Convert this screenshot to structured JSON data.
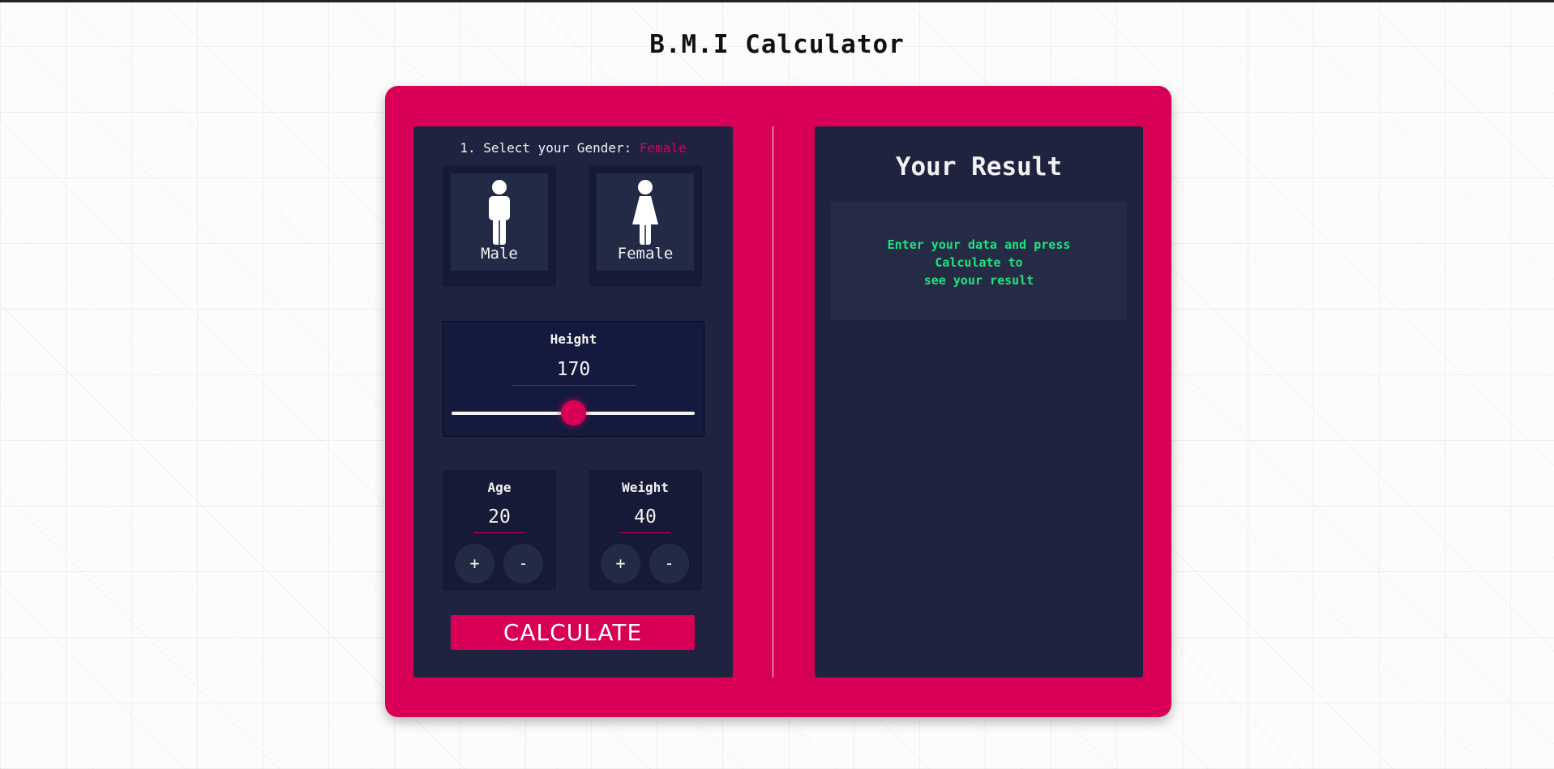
{
  "page": {
    "title": "B.M.I Calculator"
  },
  "gender": {
    "prompt": "1. Select your Gender:",
    "selected": "Female",
    "options": [
      {
        "label": "Male",
        "icon": "male-icon"
      },
      {
        "label": "Female",
        "icon": "female-icon"
      }
    ]
  },
  "height": {
    "label": "Height",
    "value": "170",
    "slider_fraction": 0.5
  },
  "age": {
    "label": "Age",
    "value": "20",
    "plus": "+",
    "minus": "-"
  },
  "weight": {
    "label": "Weight",
    "value": "40",
    "plus": "+",
    "minus": "-"
  },
  "calculate_label": "CALCULATE",
  "result": {
    "title": "Your Result",
    "line1": "Enter your data and press",
    "line2": "Calculate to",
    "line3": "see your result"
  },
  "colors": {
    "accent": "#d80056",
    "panel": "#1f2340",
    "result_text": "#1de47f"
  }
}
